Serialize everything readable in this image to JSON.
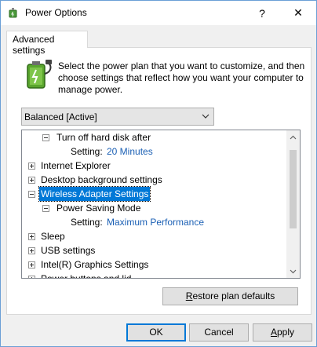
{
  "window": {
    "title": "Power Options",
    "help_glyph": "?",
    "close_glyph": "✕"
  },
  "tab": {
    "label": "Advanced settings"
  },
  "description": "Select the power plan that you want to customize, and then choose settings that reflect how you want your computer to manage power.",
  "plan_select": {
    "value": "Balanced [Active]"
  },
  "tree": {
    "rows": [
      {
        "label": "Turn off hard disk after",
        "expander": "minus"
      },
      {
        "setting_label": "Setting:",
        "setting_value": "20 Minutes"
      },
      {
        "label": "Internet Explorer",
        "expander": "plus"
      },
      {
        "label": "Desktop background settings",
        "expander": "plus"
      },
      {
        "label": "Wireless Adapter Settings",
        "expander": "minus",
        "selected": true
      },
      {
        "label": "Power Saving Mode",
        "expander": "minus"
      },
      {
        "setting_label": "Setting:",
        "setting_value": "Maximum Performance"
      },
      {
        "label": "Sleep",
        "expander": "plus"
      },
      {
        "label": "USB settings",
        "expander": "plus"
      },
      {
        "label": "Intel(R) Graphics Settings",
        "expander": "plus"
      },
      {
        "label": "Power buttons and lid",
        "expander": "plus"
      }
    ]
  },
  "buttons": {
    "restore": {
      "pre": "",
      "accel": "R",
      "post": "estore plan defaults"
    },
    "ok": "OK",
    "cancel": "Cancel",
    "apply": {
      "pre": "",
      "accel": "A",
      "post": "pply"
    }
  },
  "colors": {
    "selection": "#0078d7",
    "setting_value": "#1a5fb4",
    "window_border": "#6b9fd6"
  },
  "icons": {
    "title": "power-options-icon",
    "plan": "battery-plug-icon"
  }
}
